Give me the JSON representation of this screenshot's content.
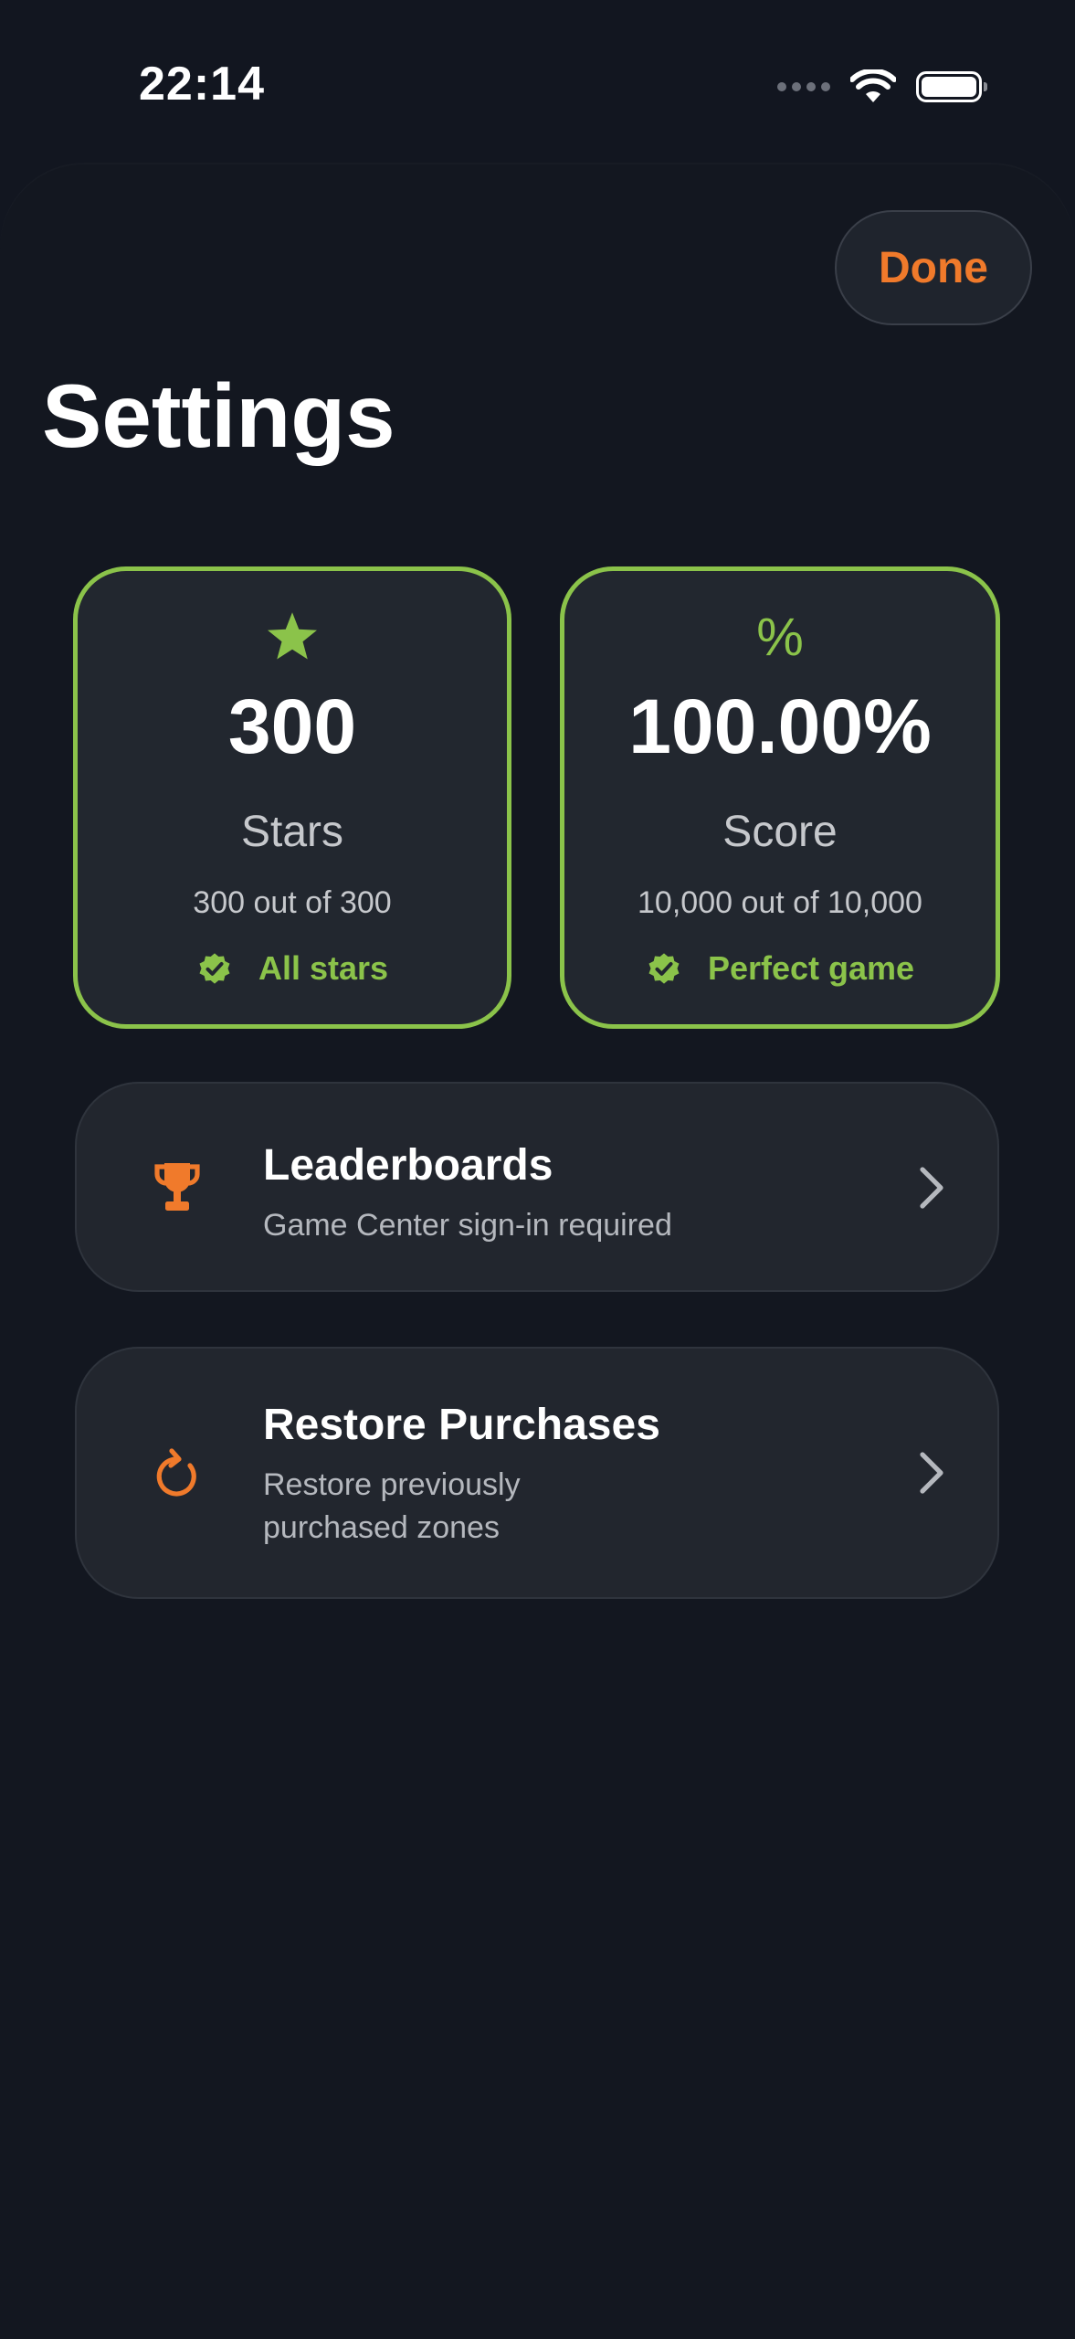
{
  "status_bar": {
    "time": "22:14",
    "icons": [
      "cellular-signal-icon",
      "wifi-icon",
      "battery-icon"
    ]
  },
  "header": {
    "done_label": "Done",
    "title": "Settings"
  },
  "stats": {
    "stars": {
      "icon": "star-icon",
      "value": "300",
      "label": "Stars",
      "detail": "300 out of 300",
      "badge_icon": "verified-check-icon",
      "badge": "All stars"
    },
    "score": {
      "icon": "percent-icon",
      "icon_glyph": "%",
      "value": "100.00%",
      "label": "Score",
      "detail": "10,000 out of 10,000",
      "badge_icon": "verified-check-icon",
      "badge": "Perfect game"
    }
  },
  "rows": {
    "leaderboards": {
      "icon": "trophy-icon",
      "title": "Leaderboards",
      "subtitle": "Game Center sign-in required"
    },
    "restore": {
      "icon": "refresh-icon",
      "title": "Restore Purchases",
      "subtitle": "Restore previously purchased zones"
    }
  },
  "colors": {
    "background": "#121620",
    "card": "#22272f",
    "accent_orange": "#f07a2b",
    "accent_green": "#8bc34a",
    "text_secondary": "#c6c8cc"
  }
}
